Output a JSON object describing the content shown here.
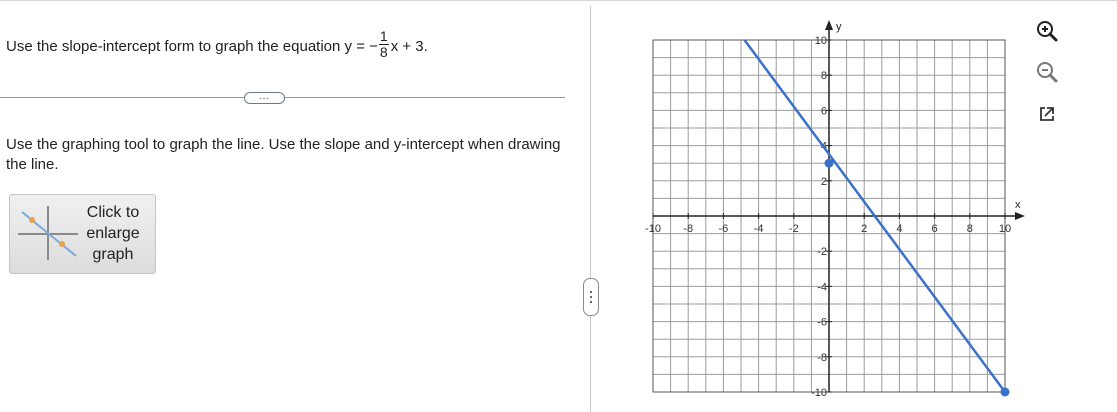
{
  "question": {
    "prefix": "Use the slope-intercept form to graph the equation y = −",
    "frac_num": "1",
    "frac_den": "8",
    "suffix": "x + 3."
  },
  "more_button": "…",
  "instruction": "Use the graphing tool to graph the line.  Use the slope and y-intercept when drawing the line.",
  "enlarge_button": {
    "line1": "Click to",
    "line2": "enlarge",
    "line3": "graph"
  },
  "graph": {
    "x_axis_label": "x",
    "y_axis_label": "y",
    "x_range": [
      -10,
      10
    ],
    "y_range": [
      -10,
      10
    ],
    "grid": true,
    "grid_step": 1,
    "x_tick_labels": [
      "-10",
      "-8",
      "-6",
      "-4",
      "-2",
      "2",
      "4",
      "6",
      "8",
      "10"
    ],
    "y_tick_labels": [
      "10",
      "8",
      "6",
      "4",
      "2",
      "-2",
      "-4",
      "-6",
      "-8",
      "-10"
    ],
    "line_color": "#3b72c9",
    "plotted_line": {
      "from": [
        -4.8,
        10
      ],
      "to": [
        10,
        -10
      ]
    },
    "plotted_points": [
      [
        0,
        3
      ],
      [
        10,
        -10
      ]
    ]
  },
  "toolbar": {
    "zoom_in": "zoom-in-icon",
    "zoom_out": "zoom-out-icon",
    "popout": "popout-icon"
  },
  "colors": {
    "accent": "#3b72c9",
    "divider": "#9a9a9a"
  }
}
